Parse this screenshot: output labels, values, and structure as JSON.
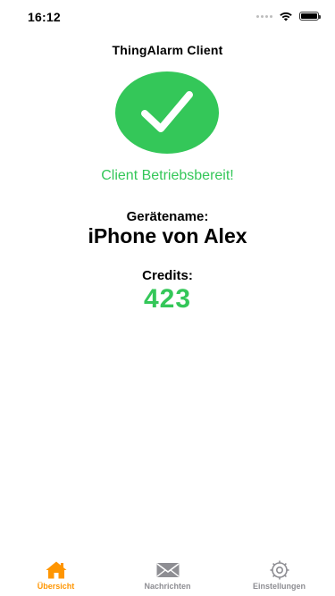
{
  "status_bar": {
    "time": "16:12"
  },
  "app_title": "ThingAlarm Client",
  "status_message": "Client Betriebsbereit!",
  "device": {
    "label": "Gerätename:",
    "name": "iPhone von Alex"
  },
  "credits": {
    "label": "Credits:",
    "value": "423"
  },
  "tabs": [
    {
      "label": "Übersicht",
      "icon": "home-icon",
      "active": true
    },
    {
      "label": "Nachrichten",
      "icon": "envelope-icon",
      "active": false
    },
    {
      "label": "Einstellungen",
      "icon": "gear-icon",
      "active": false
    }
  ],
  "colors": {
    "success_green": "#34c759",
    "active_tab": "#ff9500",
    "inactive_tab": "#8e8e93"
  }
}
